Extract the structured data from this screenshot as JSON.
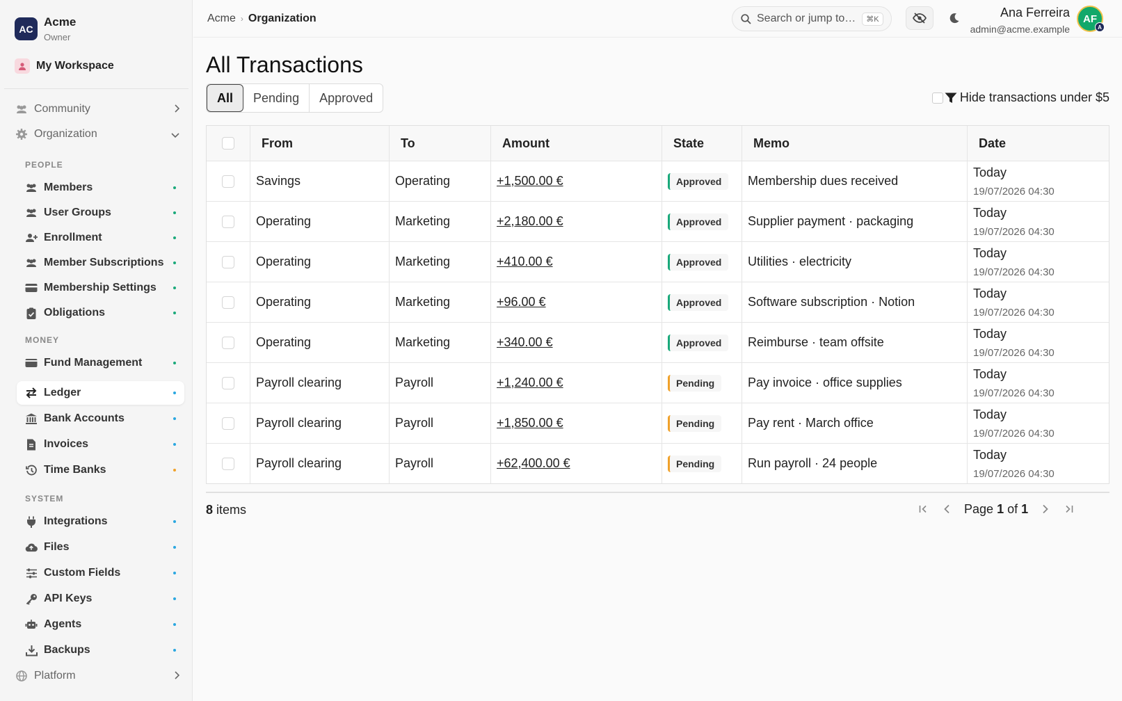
{
  "org": {
    "initials": "AC",
    "name": "Acme",
    "role": "Owner"
  },
  "workspace": {
    "label": "My Workspace"
  },
  "groups": {
    "community": "Community",
    "organization": "Organization",
    "platform": "Platform"
  },
  "sections": {
    "people": "PEOPLE",
    "money": "MONEY",
    "system": "SYSTEM"
  },
  "nav": {
    "members": "Members",
    "user_groups": "User Groups",
    "enrollment": "Enrollment",
    "member_subscriptions": "Member Subscriptions",
    "membership_settings": "Membership Settings",
    "obligations": "Obligations",
    "fund_management": "Fund Management",
    "ledger": "Ledger",
    "bank_accounts": "Bank Accounts",
    "invoices": "Invoices",
    "time_banks": "Time Banks",
    "integrations": "Integrations",
    "files": "Files",
    "custom_fields": "Custom Fields",
    "api_keys": "API Keys",
    "agents": "Agents",
    "backups": "Backups"
  },
  "colors": {
    "accent_green": "#12a86a",
    "approved": "#1aa97a",
    "pending": "#f0a12a",
    "dot_green": "#1aa97a",
    "dot_blue": "#2aa7e0",
    "dot_orange": "#f0a12a"
  },
  "topbar": {
    "breadcrumb_root": "Acme",
    "breadcrumb_sep": "›",
    "breadcrumb_current": "Organization",
    "search_placeholder": "Search or jump to…",
    "search_shortcut": "⌘K",
    "user_name": "Ana Ferreira",
    "user_email": "admin@acme.example",
    "avatar_initials": "AF",
    "avatar_badge": "A"
  },
  "page": {
    "title": "All Transactions",
    "tabs": [
      "All",
      "Pending",
      "Approved"
    ],
    "filter_label": "Hide transactions under $5"
  },
  "table": {
    "headers": [
      "From",
      "To",
      "Amount",
      "State",
      "Memo",
      "Date"
    ],
    "rows": [
      {
        "from": "Savings",
        "to": "Operating",
        "amount": "+1,500.00 €",
        "state": "Approved",
        "memo": "Membership dues received",
        "date": "Today",
        "datetime": "19/07/2026 04:30"
      },
      {
        "from": "Operating",
        "to": "Marketing",
        "amount": "+2,180.00 €",
        "state": "Approved",
        "memo": "Supplier payment · packaging",
        "date": "Today",
        "datetime": "19/07/2026 04:30"
      },
      {
        "from": "Operating",
        "to": "Marketing",
        "amount": "+410.00 €",
        "state": "Approved",
        "memo": "Utilities · electricity",
        "date": "Today",
        "datetime": "19/07/2026 04:30"
      },
      {
        "from": "Operating",
        "to": "Marketing",
        "amount": "+96.00 €",
        "state": "Approved",
        "memo": "Software subscription · Notion",
        "date": "Today",
        "datetime": "19/07/2026 04:30"
      },
      {
        "from": "Operating",
        "to": "Marketing",
        "amount": "+340.00 €",
        "state": "Approved",
        "memo": "Reimburse · team offsite",
        "date": "Today",
        "datetime": "19/07/2026 04:30"
      },
      {
        "from": "Payroll clearing",
        "to": "Payroll",
        "amount": "+1,240.00 €",
        "state": "Pending",
        "memo": "Pay invoice · office supplies",
        "date": "Today",
        "datetime": "19/07/2026 04:30"
      },
      {
        "from": "Payroll clearing",
        "to": "Payroll",
        "amount": "+1,850.00 €",
        "state": "Pending",
        "memo": "Pay rent · March office",
        "date": "Today",
        "datetime": "19/07/2026 04:30"
      },
      {
        "from": "Payroll clearing",
        "to": "Payroll",
        "amount": "+62,400.00 €",
        "state": "Pending",
        "memo": "Run payroll · 24 people",
        "date": "Today",
        "datetime": "19/07/2026 04:30"
      }
    ]
  },
  "footer": {
    "count": "8",
    "items_label": "items",
    "page_word": "Page",
    "page_current": "1",
    "of_word": "of",
    "page_total": "1"
  }
}
